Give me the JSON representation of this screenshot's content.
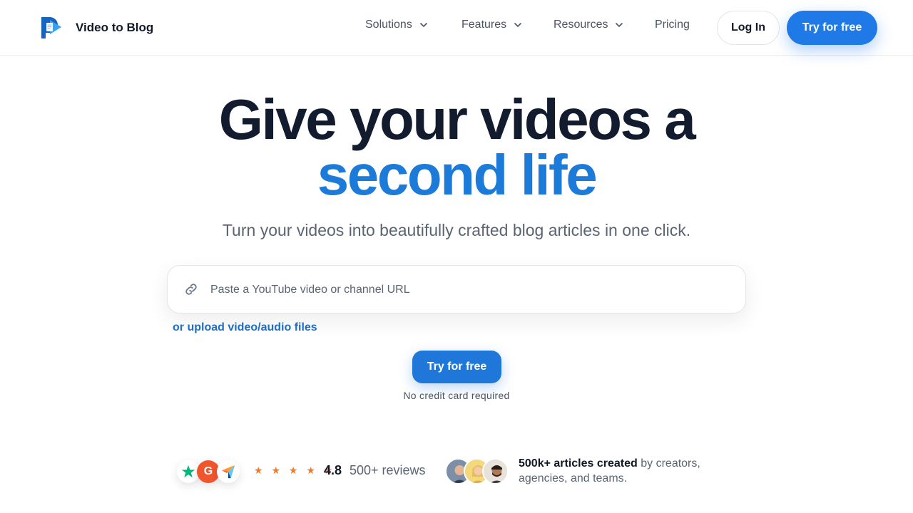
{
  "brand": {
    "name": "Video to Blog",
    "primary_color": "#1f7ae8",
    "accent_text_color": "#1c7ad9"
  },
  "nav": {
    "items": [
      {
        "label": "Solutions",
        "has_dropdown": true
      },
      {
        "label": "Features",
        "has_dropdown": true
      },
      {
        "label": "Resources",
        "has_dropdown": true
      },
      {
        "label": "Pricing",
        "has_dropdown": false
      }
    ],
    "login_label": "Log In",
    "try_label": "Try for free"
  },
  "hero": {
    "headline": "Give your videos a",
    "headline_accent": "second life",
    "subheadline": "Turn your videos into beautifully crafted blog articles in one click.",
    "url_placeholder": "Paste a YouTube video or channel URL",
    "upload_link": "or upload video/audio files",
    "cta_label": "Try for free",
    "cta_note": "No credit card required"
  },
  "social_proof": {
    "review_platform_icons": [
      "trustpilot-star-icon",
      "g2-icon",
      "capterra-icon"
    ],
    "stars": "★ ★ ★ ★ ★",
    "rating": "4.8",
    "reviews": "500+ reviews",
    "articles_bold": "500k+ articles created",
    "articles_rest": " by creators, agencies, and teams."
  }
}
